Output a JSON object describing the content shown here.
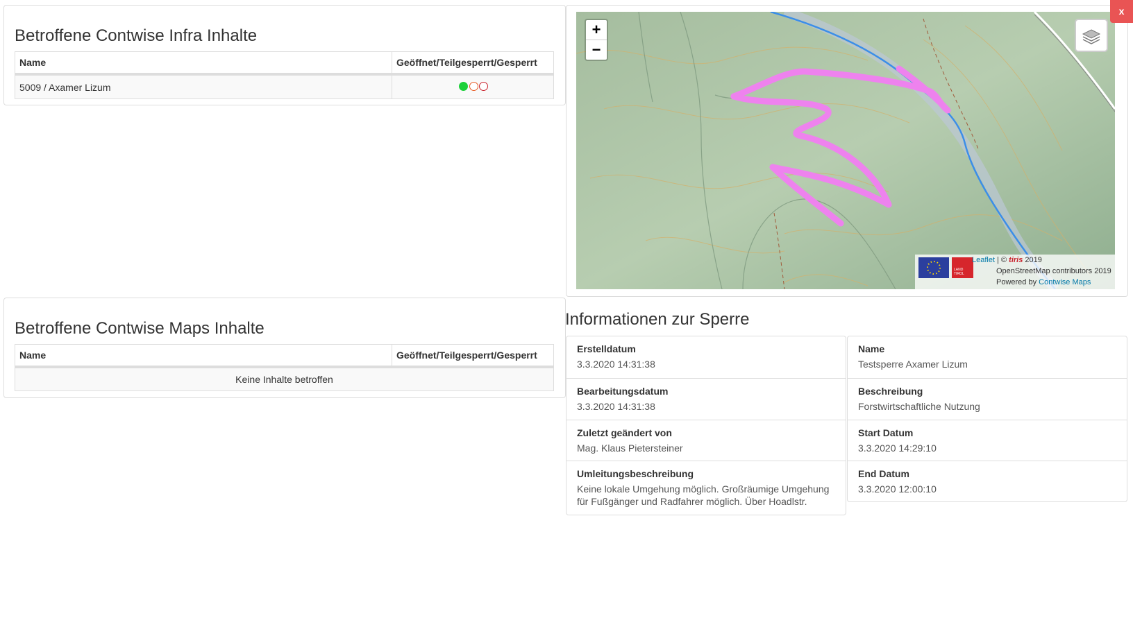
{
  "infra_panel": {
    "title": "Betroffene Contwise Infra Inhalte",
    "columns": [
      "Name",
      "Geöffnet/Teilgesperrt/Gesperrt"
    ],
    "rows": [
      {
        "name": "5009 / Axamer Lizum",
        "status": "open"
      }
    ]
  },
  "maps_panel": {
    "title": "Betroffene Contwise Maps Inhalte",
    "columns": [
      "Name",
      "Geöffnet/Teilgesperrt/Gesperrt"
    ],
    "empty_text": "Keine Inhalte betroffen"
  },
  "map": {
    "zoom_in": "+",
    "zoom_out": "−",
    "attribution": {
      "leaflet": "Leaflet",
      "separator": " | © ",
      "tiris": "tiris",
      "tiris_year": " 2019",
      "osm": "OpenStreetMap contributors 2019",
      "powered_prefix": "Powered by ",
      "powered_link": "Contwise Maps",
      "tirol_logo_text": "LAND TIROL"
    },
    "colors": {
      "closure_line": "#ee82ee",
      "river": "#3b8ee8"
    }
  },
  "close_button": "x",
  "info": {
    "title": "Informationen zur Sperre",
    "left": [
      {
        "label": "Erstelldatum",
        "value": "3.3.2020 14:31:38"
      },
      {
        "label": "Bearbeitungsdatum",
        "value": "3.3.2020 14:31:38"
      },
      {
        "label": "Zuletzt geändert von",
        "value": "Mag. Klaus Pietersteiner"
      },
      {
        "label": "Umleitungsbeschreibung",
        "value": "Keine lokale Umgehung möglich. Großräumige Umgehung für Fußgänger und Radfahrer möglich. Über Hoadlstr."
      }
    ],
    "right": [
      {
        "label": "Name",
        "value": "Testsperre Axamer Lizum"
      },
      {
        "label": "Beschreibung",
        "value": "Forstwirtschaftliche Nutzung"
      },
      {
        "label": "Start Datum",
        "value": "3.3.2020 14:29:10"
      },
      {
        "label": "End Datum",
        "value": "3.3.2020 12:00:10"
      }
    ]
  }
}
